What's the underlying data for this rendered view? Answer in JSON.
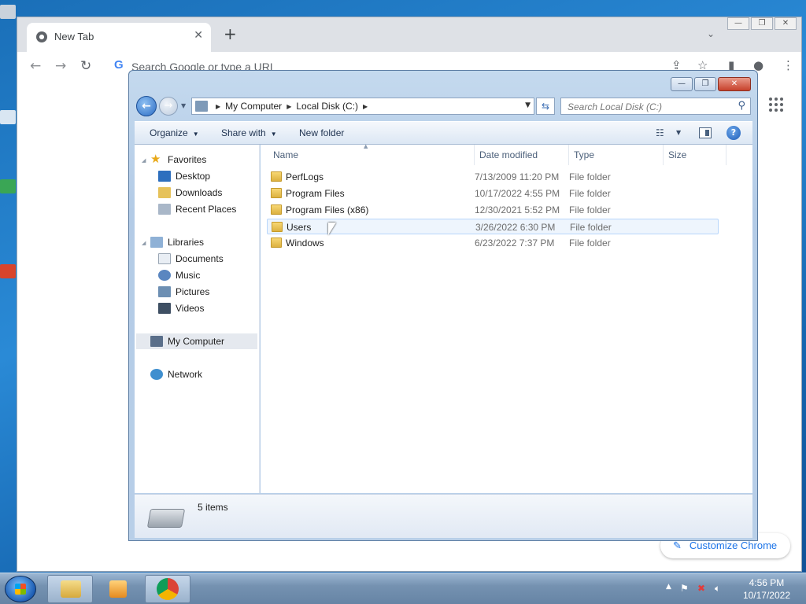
{
  "chrome": {
    "tab_title": "New Tab",
    "omnibox_placeholder": "Search Google or type a URL",
    "customize_label": "Customize Chrome"
  },
  "explorer": {
    "address": [
      "My Computer",
      "Local Disk (C:)"
    ],
    "search_placeholder": "Search Local Disk (C:)",
    "commands": {
      "organize": "Organize",
      "share_with": "Share with",
      "new_folder": "New folder"
    },
    "nav": {
      "favorites": "Favorites",
      "favorites_items": [
        "Desktop",
        "Downloads",
        "Recent Places"
      ],
      "libraries": "Libraries",
      "libraries_items": [
        "Documents",
        "Music",
        "Pictures",
        "Videos"
      ],
      "my_computer": "My Computer",
      "network": "Network"
    },
    "columns": {
      "name": "Name",
      "date_modified": "Date modified",
      "type": "Type",
      "size": "Size"
    },
    "files": [
      {
        "name": "PerfLogs",
        "date": "7/13/2009 11:20 PM",
        "type": "File folder"
      },
      {
        "name": "Program Files",
        "date": "10/17/2022 4:55 PM",
        "type": "File folder"
      },
      {
        "name": "Program Files (x86)",
        "date": "12/30/2021 5:52 PM",
        "type": "File folder"
      },
      {
        "name": "Users",
        "date": "3/26/2022 6:30 PM",
        "type": "File folder"
      },
      {
        "name": "Windows",
        "date": "6/23/2022 7:37 PM",
        "type": "File folder"
      }
    ],
    "status": "5 items"
  },
  "taskbar": {
    "time": "4:56 PM",
    "date": "10/17/2022"
  },
  "colors": {
    "accent": "#1a73e8",
    "explorer_frame": "#b8cfe8",
    "taskbar": "#7592b1"
  }
}
